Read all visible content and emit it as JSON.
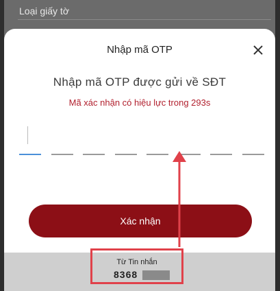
{
  "background": {
    "field_label": "Loại giấy tờ"
  },
  "dialog": {
    "title": "Nhập mã OTP",
    "headline": "Nhập mã OTP được gửi về SĐT",
    "validity_text": "Mã xác nhận có hiệu lực trong 293s",
    "otp_slots": [
      "",
      "",
      "",
      "",
      "",
      "",
      "",
      ""
    ],
    "active_slot": 1,
    "confirm_label": "Xác nhận"
  },
  "sms_suggestion": {
    "from_label": "Từ Tin nhắn",
    "code_visible": "8368"
  },
  "colors": {
    "primary": "#8c0f16",
    "validity_text": "#b11f2d",
    "highlight": "#e0414a",
    "active_line": "#4a90d9"
  }
}
